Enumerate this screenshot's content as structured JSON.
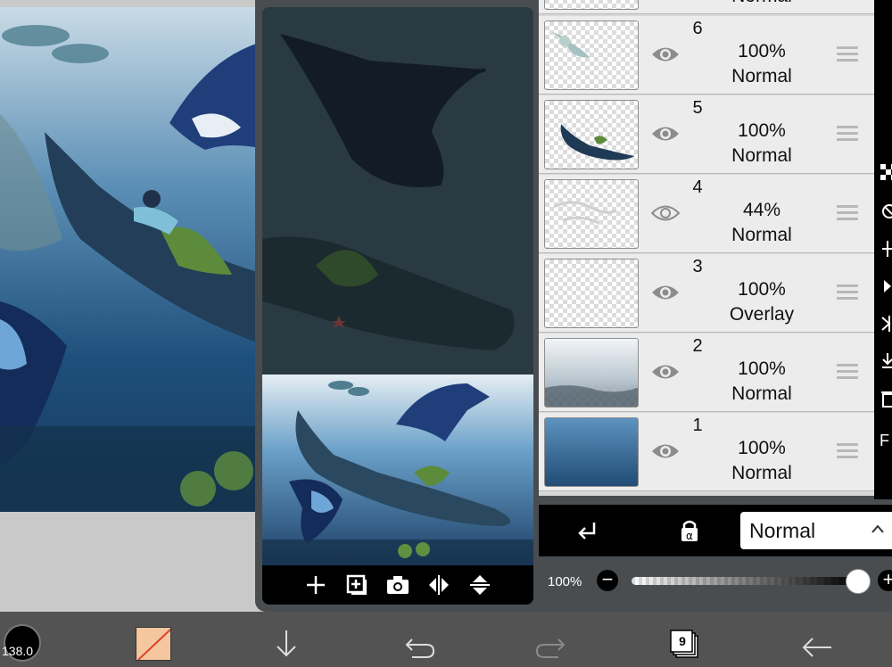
{
  "canvas": {
    "brush_size": "138.0",
    "layer_count": "9"
  },
  "layers": [
    {
      "number": "6",
      "opacity": "100%",
      "blend_mode": "Normal",
      "visible": true
    },
    {
      "number": "5",
      "opacity": "100%",
      "blend_mode": "Normal",
      "visible": true
    },
    {
      "number": "4",
      "opacity": "44%",
      "blend_mode": "Normal",
      "visible": false
    },
    {
      "number": "3",
      "opacity": "100%",
      "blend_mode": "Overlay",
      "visible": true
    },
    {
      "number": "2",
      "opacity": "100%",
      "blend_mode": "Normal",
      "visible": true
    },
    {
      "number": "1",
      "opacity": "100%",
      "blend_mode": "Normal",
      "visible": true
    }
  ],
  "partial_top_layer_mode": "Normal",
  "right_strip": {
    "letter": "F"
  },
  "blend_controls": {
    "selected_mode": "Normal",
    "opacity_label": "100%",
    "opacity_value": 1.0
  },
  "colors": {
    "panel_bg": "#4a4d50",
    "layer_row_bg": "#ececec",
    "toolbar_bg": "#535353",
    "primary_color": "#f4c79e",
    "brush_color": "#000000"
  }
}
